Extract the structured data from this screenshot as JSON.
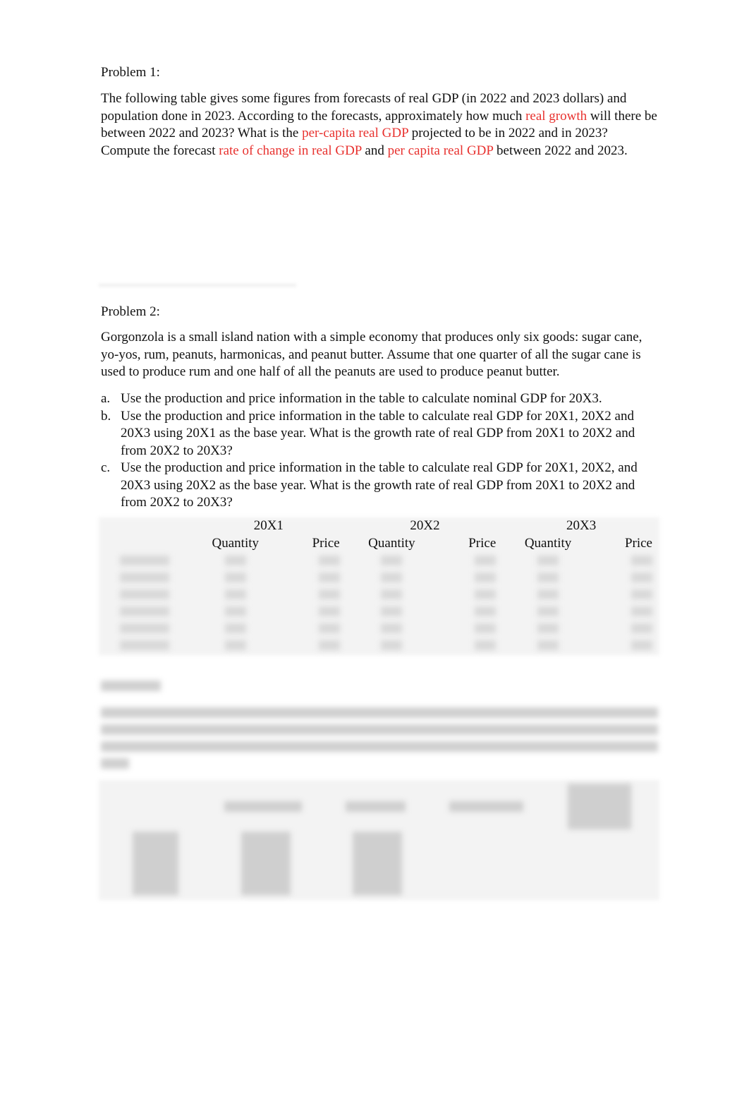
{
  "problem1": {
    "heading": "Problem 1:",
    "text": [
      {
        "t": "The following table gives some figures from forecasts of real GDP (in 2022 and 2023 dollars) and population done in 2023. According to the forecasts, approximately how much ",
        "red": false
      },
      {
        "t": "real growth",
        "red": true
      },
      {
        "t": " will there be between 2022 and 2023? What is the ",
        "red": false
      },
      {
        "t": "per-capita real GDP",
        "red": true
      },
      {
        "t": " projected to be in 2022 and in 2023? Compute the forecast ",
        "red": false
      },
      {
        "t": "rate of change in real GDP",
        "red": true
      },
      {
        "t": " and ",
        "red": false
      },
      {
        "t": "per capita real GDP",
        "red": true
      },
      {
        "t": " between 2022 and 2023.",
        "red": false
      }
    ]
  },
  "problem2": {
    "heading": "Problem 2:",
    "intro": "Gorgonzola is a small island nation with a simple economy that produces only six goods: sugar cane, yo-yos, rum, peanuts, harmonicas, and peanut butter. Assume that one quarter of all the sugar cane is used to produce rum and one half of all the peanuts are used to produce peanut butter.",
    "items": [
      {
        "marker": "a.",
        "text": "Use the production and price information in the table to calculate nominal GDP for 20X3."
      },
      {
        "marker": "b.",
        "text": "Use the production and price information in the table to calculate real GDP for 20X1, 20X2 and 20X3 using 20X1 as the base year. What is the growth rate of real GDP from 20X1 to 20X2 and from 20X2 to 20X3?"
      },
      {
        "marker": "c.",
        "text": "Use the production and price information in the table to calculate real GDP for 20X1, 20X2, and 20X3 using 20X2 as the base year. What is the growth rate of real GDP from 20X1 to 20X2 and from 20X2 to 20X3?"
      }
    ],
    "table": {
      "years": [
        "20X1",
        "20X2",
        "20X3"
      ],
      "sub": [
        "Quantity",
        "Price"
      ]
    }
  },
  "colors": {
    "highlight": "#e8322f"
  }
}
